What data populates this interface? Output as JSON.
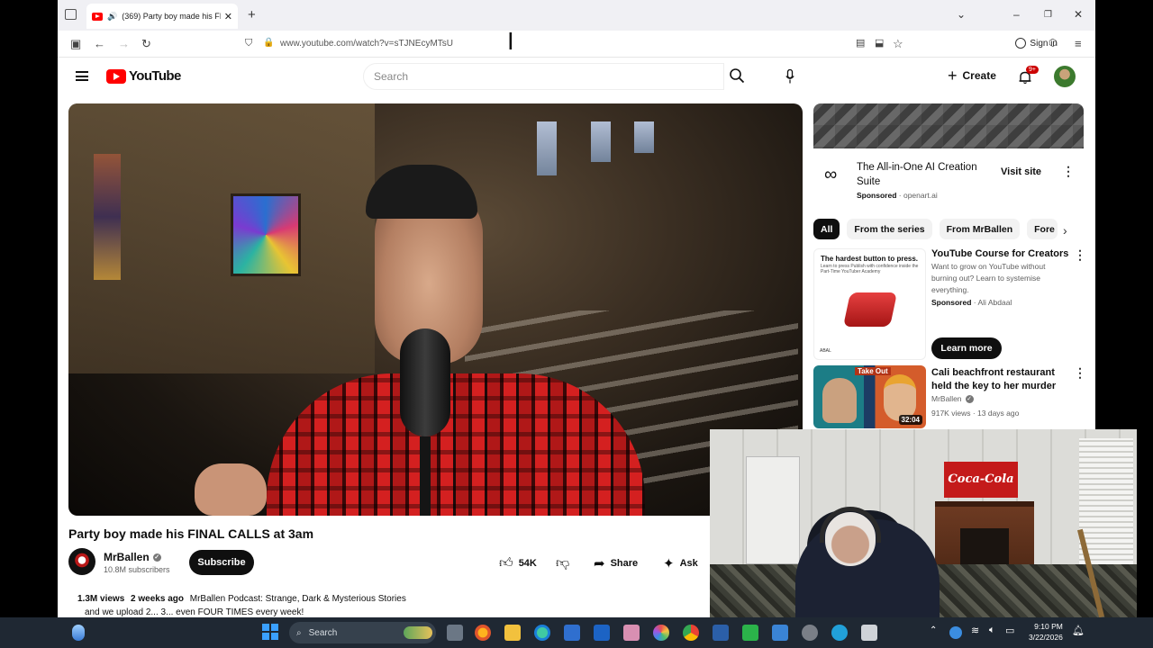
{
  "browser": {
    "tab_title": "(369) Party boy made his FI",
    "url": "www.youtube.com/watch?v=sTJNEcyMTsU",
    "sign_in": "Sign in"
  },
  "youtube": {
    "logo_text": "YouTube",
    "search_placeholder": "Search",
    "create_label": "Create",
    "notif_badge": "9+"
  },
  "video": {
    "title": "Party boy made his FINAL CALLS at 3am",
    "channel": "MrBallen",
    "subscribers": "10.8M subscribers",
    "subscribe_label": "Subscribe",
    "likes": "54K",
    "share_label": "Share",
    "ask_label": "Ask",
    "views": "1.3M views",
    "age": "2 weeks ago",
    "description_line1": "MrBallen Podcast: Strange, Dark & Mysterious Stories",
    "description_line2": "and we upload 2... 3... even FOUR TIMES every week!"
  },
  "sidebar": {
    "ad": {
      "title": "The All-in-One AI Creation Suite",
      "sponsored": "Sponsored",
      "domain": "openart.ai",
      "cta": "Visit site"
    },
    "chips": [
      "All",
      "From the series",
      "From MrBallen",
      "Fore"
    ],
    "rec1": {
      "thumb_head": "The hardest button to press.",
      "thumb_sub": "Learn to press Publish with confidence inside the Part-Time YouTuber Academy",
      "thumb_foot": "ABAL",
      "title": "YouTube Course for Creators",
      "description": "Want to grow on YouTube without burning out? Learn to systemise everything.",
      "sponsored": "Sponsored",
      "advertiser": "Ali Abdaal",
      "cta": "Learn more"
    },
    "rec2": {
      "thumb_tag": "Take Out",
      "duration": "32:04",
      "title": "Cali beachfront restaurant held the key to her murder",
      "channel": "MrBallen",
      "views": "917K views",
      "age": "13 days ago"
    }
  },
  "webcam": {
    "sign_text": "Coca-Cola"
  },
  "taskbar": {
    "search_label": "Search",
    "time": "9:10 PM",
    "date": "3/22/2026"
  }
}
